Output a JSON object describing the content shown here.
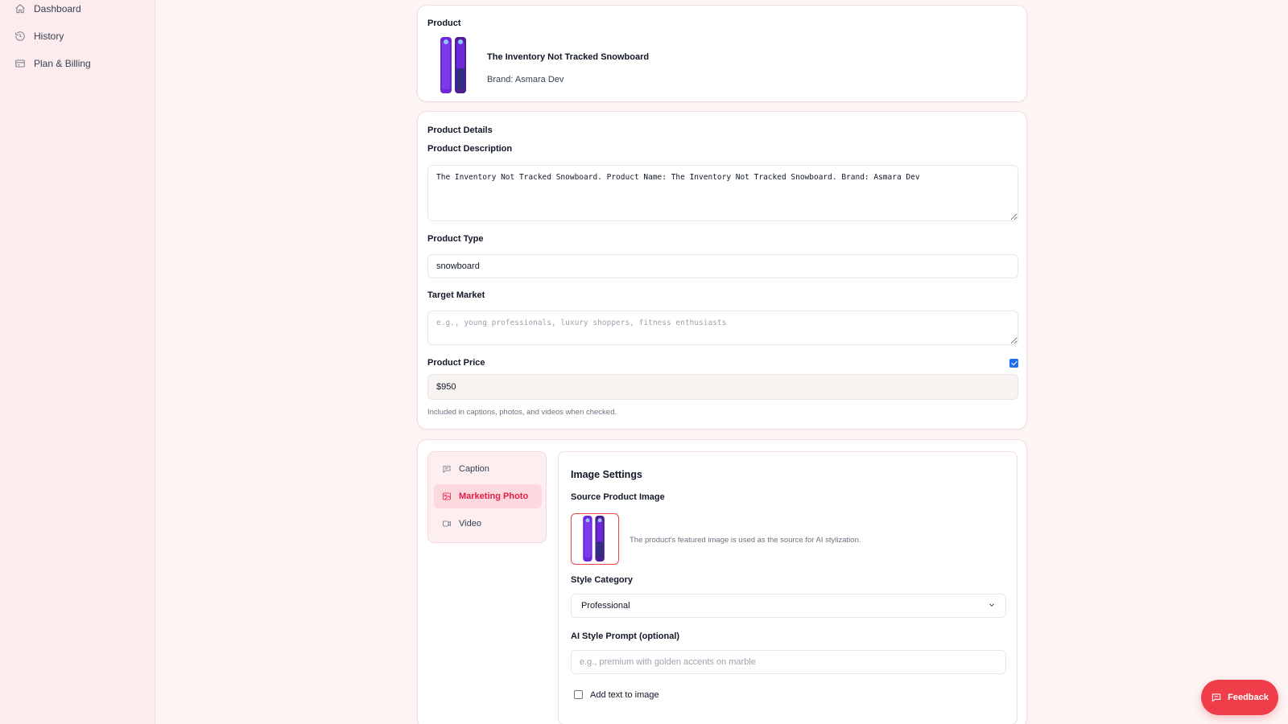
{
  "sidebar": {
    "items": [
      {
        "label": "Dashboard",
        "icon": "home-icon"
      },
      {
        "label": "History",
        "icon": "history-icon"
      },
      {
        "label": "Plan & Billing",
        "icon": "credit-card-icon"
      }
    ]
  },
  "product_card": {
    "heading": "Product",
    "title": "The Inventory Not Tracked Snowboard",
    "brand": "Brand: Asmara Dev"
  },
  "details_card": {
    "heading": "Product Details",
    "description_label": "Product Description",
    "description_value": "The Inventory Not Tracked Snowboard. Product Name: The Inventory Not Tracked Snowboard. Brand: Asmara Dev",
    "type_label": "Product Type",
    "type_value": "snowboard",
    "market_label": "Target Market",
    "market_placeholder": "e.g., young professionals, luxury shoppers, fitness enthusiasts",
    "price_label": "Product Price",
    "price_included": true,
    "price_value": "$950",
    "price_help": "Included in captions, photos, and videos when checked."
  },
  "generator": {
    "tabs": [
      {
        "label": "Caption",
        "icon": "message-icon",
        "active": false
      },
      {
        "label": "Marketing Photo",
        "icon": "image-icon",
        "active": true
      },
      {
        "label": "Video",
        "icon": "video-icon",
        "active": false
      }
    ],
    "settings": {
      "title": "Image Settings",
      "source_label": "Source Product Image",
      "source_note": "The product's featured image is used as the source for AI stylization.",
      "style_label": "Style Category",
      "style_value": "Professional",
      "prompt_label": "AI Style Prompt (optional)",
      "prompt_placeholder": "e.g., premium with golden accents on marble",
      "add_text_label": "Add text to image",
      "add_text_checked": false
    }
  },
  "feedback_button": {
    "label": "Feedback",
    "icon": "chat-icon"
  },
  "colors": {
    "accent": "#e11d48",
    "feedback_bg": "#ef3e4a",
    "checkbox": "#1d6ff2",
    "sidebar_bg": "#fcecee",
    "page_bg": "#fdf4f4"
  }
}
